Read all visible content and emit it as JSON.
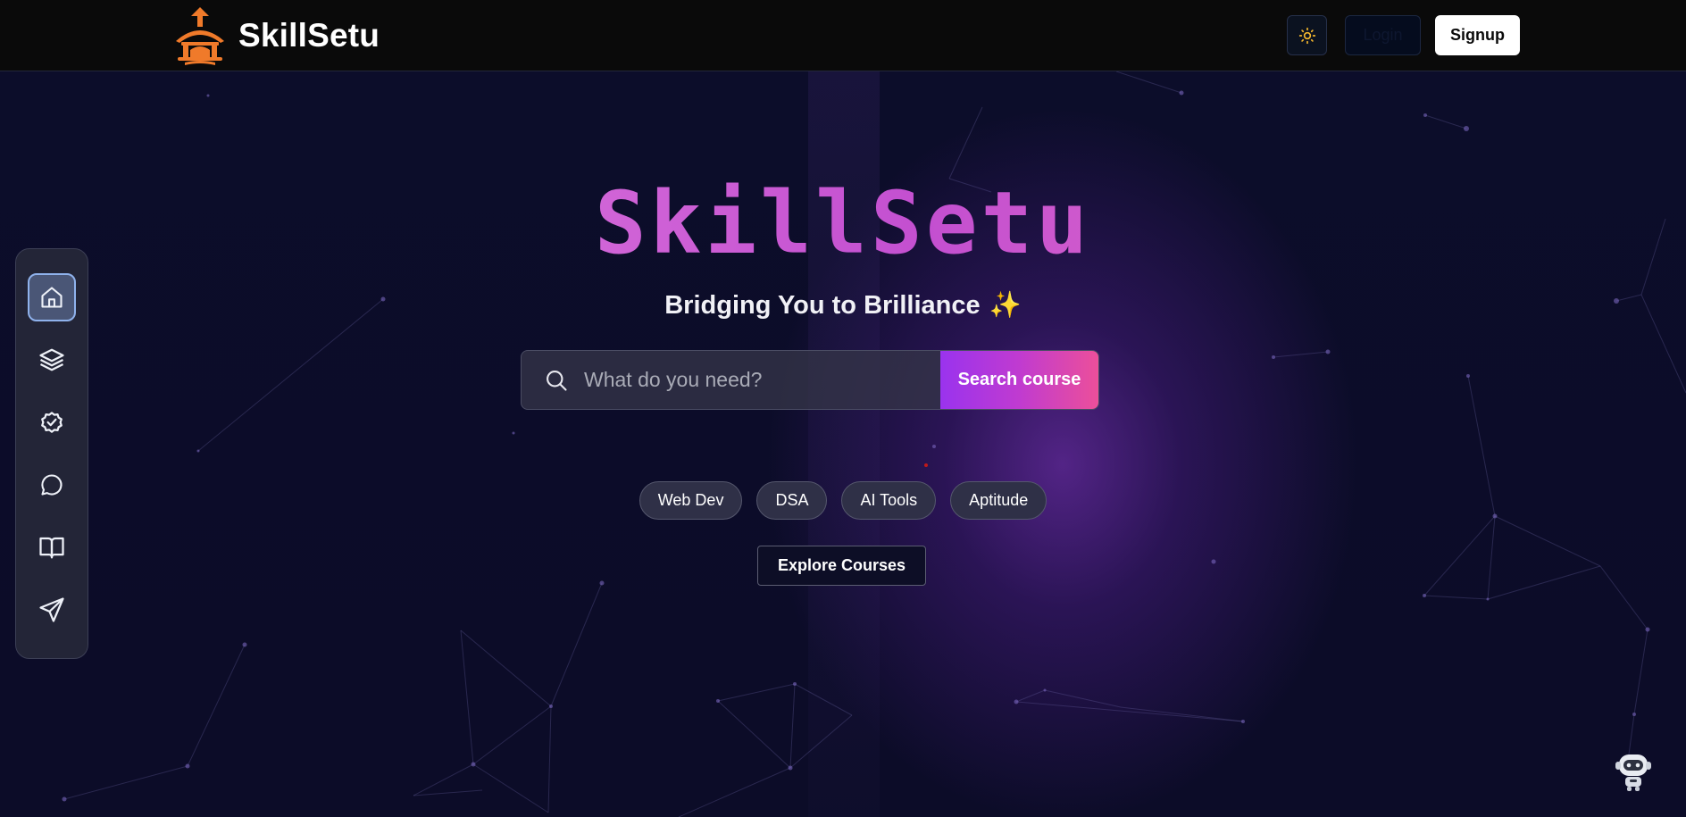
{
  "header": {
    "brand_name": "SkillSetu",
    "logo_icon": "school-building-icon",
    "theme_toggle_icon": "sun-icon",
    "login_label": "Login",
    "signup_label": "Signup"
  },
  "sidebar": {
    "items": [
      {
        "icon": "home-icon",
        "active": true
      },
      {
        "icon": "layers-icon",
        "active": false
      },
      {
        "icon": "badge-check-icon",
        "active": false
      },
      {
        "icon": "chat-bubble-icon",
        "active": false
      },
      {
        "icon": "open-book-icon",
        "active": false
      },
      {
        "icon": "send-icon",
        "active": false
      }
    ]
  },
  "hero": {
    "title": "SkillSetu",
    "subtitle": "Bridging You to Brilliance",
    "subtitle_emoji": "✨",
    "search": {
      "placeholder": "What do you need?",
      "value": "",
      "button_label": "Search course"
    },
    "chips": [
      "Web Dev",
      "DSA",
      "AI Tools",
      "Aptitude"
    ],
    "explore_label": "Explore Courses"
  },
  "assistant": {
    "icon": "robot-assistant-icon"
  },
  "colors": {
    "background": "#0b0c26",
    "accent_purple": "#9a33ee",
    "accent_pink": "#ec4f9a",
    "brand_orange": "#f07a2a",
    "title_gradient_start": "#e07bf0",
    "title_gradient_end": "#d66cd8"
  }
}
